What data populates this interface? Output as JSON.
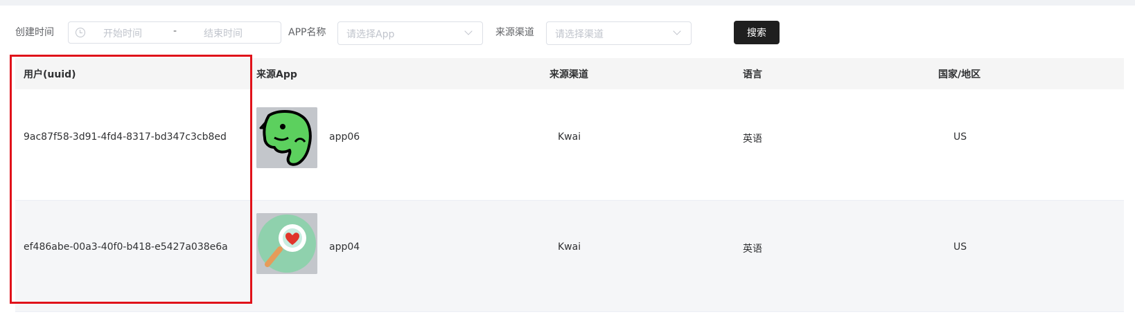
{
  "filters": {
    "created_time_label": "创建时间",
    "start_placeholder": "开始时间",
    "separator": "-",
    "end_placeholder": "结束时间",
    "app_name_label": "APP名称",
    "app_placeholder": "请选择App",
    "channel_label": "来源渠道",
    "channel_placeholder": "请选择渠道",
    "search_label": "搜索"
  },
  "table": {
    "headers": {
      "user": "用户(uuid)",
      "app": "来源App",
      "channel": "来源渠道",
      "language": "语言",
      "country": "国家/地区"
    },
    "rows": [
      {
        "uuid": "9ac87f58-3d91-4fd4-8317-bd347c3cb8ed",
        "app_icon": "elephant-icon",
        "app": "app06",
        "channel": "Kwai",
        "language": "英语",
        "country": "US"
      },
      {
        "uuid": "ef486abe-00a3-40f0-b418-e5427a038e6a",
        "app_icon": "magnifier-heart-icon",
        "app": "app04",
        "channel": "Kwai",
        "language": "英语",
        "country": "US"
      }
    ]
  },
  "colors": {
    "highlight_border": "#e0121a",
    "search_button": "#1f1f1f",
    "header_bg": "#f5f5f5"
  }
}
